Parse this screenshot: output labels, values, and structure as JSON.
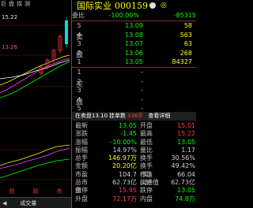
{
  "chart": {
    "tabs": [
      "巨",
      "盘",
      "拐",
      "测"
    ],
    "price_high": "15.22",
    "price_mid": "13.26",
    "bottom_tabs": [
      "财",
      "政",
      "务"
    ],
    "collapse_arrow": "◀",
    "collapse_label": "成交量"
  },
  "quote": {
    "name": "国际实业",
    "code": "000159",
    "tail": "◎",
    "weibi_label": "委比",
    "weibi_value": "-100.00%",
    "weicha_value": "-85315",
    "sell_label": "卖",
    "sell_label2": "盘",
    "buy_label": "买",
    "buy_label2": "盘",
    "sell_book": [
      {
        "idx": "5",
        "price": "13.09",
        "vol": "58"
      },
      {
        "idx": "4",
        "price": "13.08",
        "vol": "563"
      },
      {
        "idx": "3",
        "price": "13.07",
        "vol": "63"
      },
      {
        "idx": "2",
        "price": "13.06",
        "vol": "268"
      },
      {
        "idx": "1",
        "price": "13.05",
        "vol": "84327"
      }
    ],
    "buy_book": [
      {
        "idx": "1",
        "price": "-",
        "vol": ""
      },
      {
        "idx": "2",
        "price": "-",
        "vol": ""
      },
      {
        "idx": "3",
        "price": "-",
        "vol": ""
      },
      {
        "idx": "4",
        "price": "-",
        "vol": ""
      },
      {
        "idx": "5",
        "price": "-",
        "vol": ""
      }
    ],
    "deal_bar": {
      "a": "在卖盘13.10",
      "b": "挂单数",
      "c": "336手",
      "d": "查看详细"
    },
    "stats": [
      {
        "k1": "最新",
        "v1": "13.05",
        "c1": "c-green",
        "k2": "开盘",
        "v2": "15.01",
        "c2": "c-red"
      },
      {
        "k1": "涨跌",
        "v1": "-1.45",
        "c1": "c-green",
        "k2": "最高",
        "v2": "15.22",
        "c2": "c-red"
      },
      {
        "k1": "涨幅",
        "v1": "-10.00%",
        "c1": "c-green",
        "k2": "最低",
        "v2": "13.05",
        "c2": "c-green"
      },
      {
        "k1": "振幅",
        "v1": "14.97%",
        "c1": "c-white",
        "k2": "量比",
        "v2": "1.17",
        "c2": "c-white"
      },
      {
        "k1": "总手",
        "v1": "146.97万",
        "c1": "c-yellow",
        "k2": "换手",
        "v2": "30.56%",
        "c2": "c-white"
      },
      {
        "k1": "金额",
        "v1": "20.20亿",
        "c1": "c-yellow",
        "k2": "换手(实)",
        "v2": "49.42%",
        "c2": "c-white"
      },
      {
        "k1": "市盈",
        "v1": "104.7",
        "c1": "c-white",
        "k2": "市盈(动)",
        "v2": "66.04",
        "c2": "c-white"
      },
      {
        "k1": "总市值",
        "v1": "62.73亿",
        "c1": "c-white",
        "k2": "流通值",
        "v2": "62.73亿",
        "c2": "c-white"
      },
      {
        "k1": "涨停",
        "v1": "15.95",
        "c1": "c-red",
        "k2": "跌停",
        "v2": "13.05",
        "c2": "c-green"
      },
      {
        "k1": "外盘",
        "v1": "72.17万",
        "c1": "c-red",
        "k2": "内盘",
        "v2": "74.8万",
        "c2": "c-green"
      }
    ]
  }
}
